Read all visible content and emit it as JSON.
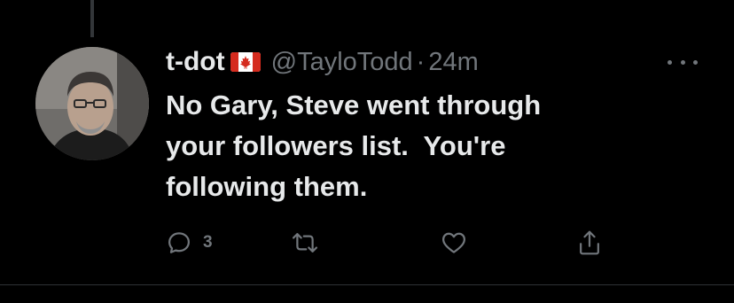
{
  "tweet": {
    "display_name": "t-dot",
    "name_emoji": "canadian-flag",
    "handle": "@TayloTodd",
    "separator": "·",
    "time": "24m",
    "text": "No Gary, Steve went through\nyour followers list.  You're\nfollowing them."
  },
  "actions": {
    "reply_count": "3",
    "retweet_count": "",
    "like_count": ""
  },
  "icons": {
    "reply": "reply-icon",
    "retweet": "retweet-icon",
    "like": "heart-icon",
    "share": "share-icon",
    "more": "more-dots-icon"
  },
  "colors": {
    "background": "#000000",
    "primary_text": "#e7e9ea",
    "secondary_text": "#71767b",
    "flag_red": "#d52b1e"
  }
}
